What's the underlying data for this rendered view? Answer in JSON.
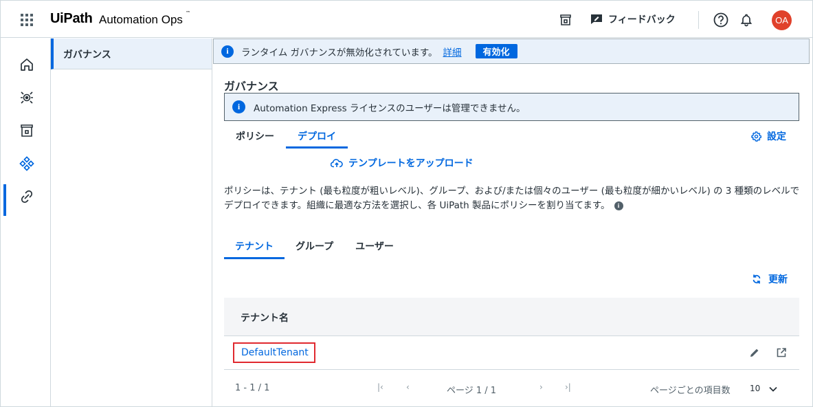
{
  "header": {
    "brand": "UiPath",
    "product": "Automation Ops",
    "trademark": "™",
    "feedback_label": "フィードバック",
    "avatar_initials": "OA"
  },
  "rail": {
    "items": [
      "home-icon",
      "governance-target-icon",
      "store-icon",
      "deploy-network-icon",
      "link-settings-icon"
    ],
    "active_index": 3
  },
  "subnav": {
    "item_label": "ガバナンス"
  },
  "banner": {
    "text": "ランタイム ガバナンスが無効化されています。",
    "link": "詳細",
    "button": "有効化"
  },
  "page": {
    "title": "ガバナンス",
    "notice": "Automation Express ライセンスのユーザーは管理できません。",
    "tabs": [
      "ポリシー",
      "デプロイ"
    ],
    "active_tab": 1,
    "settings_label": "設定",
    "upload_label": "テンプレートをアップロード",
    "description": "ポリシーは、テナント (最も粒度が粗いレベル)、グループ、および/または個々のユーザー (最も粒度が細かいレベル) の 3 種類のレベルでデプロイできます。組織に最適な方法を選択し、各 UiPath 製品にポリシーを割り当てます。",
    "sub_tabs": [
      "テナント",
      "グループ",
      "ユーザー"
    ],
    "active_sub_tab": 0,
    "refresh_label": "更新"
  },
  "table": {
    "column_header": "テナント名",
    "rows": [
      {
        "name": "DefaultTenant"
      }
    ]
  },
  "pager": {
    "range": "1 - 1 / 1",
    "first": "|‹",
    "prev": "‹",
    "page_label": "ページ 1 / 1",
    "next": "›",
    "last": "›|",
    "per_page_label": "ページごとの項目数",
    "page_size": "10"
  },
  "colors": {
    "accent": "#0067df",
    "avatar": "#e0412b",
    "highlight_border": "#e0282e"
  }
}
